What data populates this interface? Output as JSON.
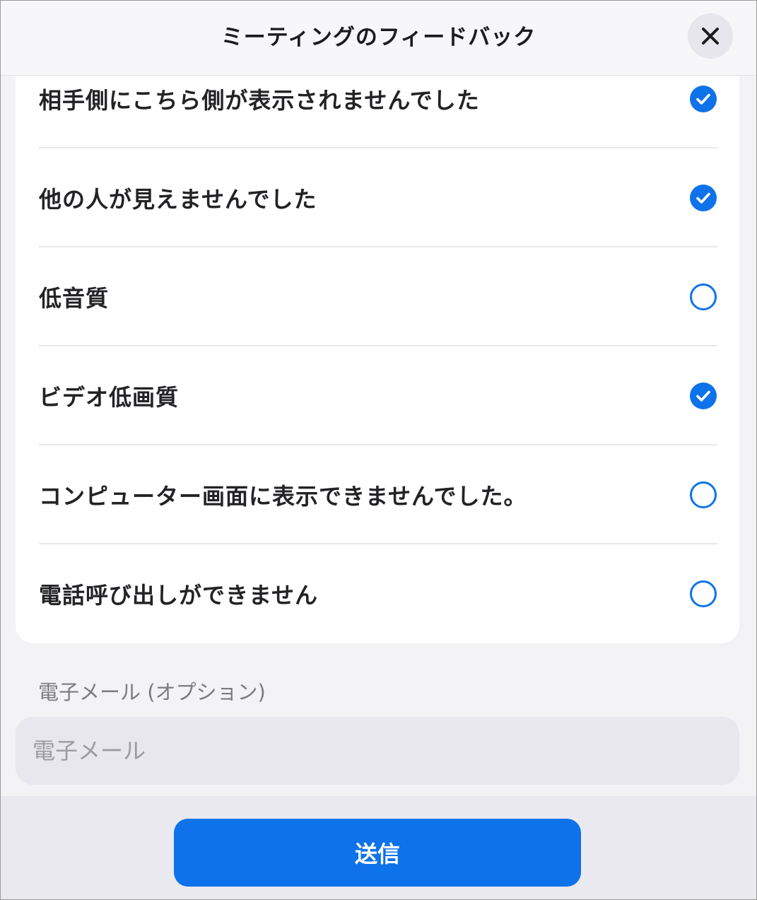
{
  "header": {
    "title": "ミーティングのフィードバック",
    "close_icon": "close-icon"
  },
  "options": [
    {
      "label": "相手側にこちら側が表示されませんでした",
      "checked": true
    },
    {
      "label": "他の人が見えませんでした",
      "checked": true
    },
    {
      "label": "低音質",
      "checked": false
    },
    {
      "label": "ビデオ低画質",
      "checked": true
    },
    {
      "label": "コンピューター画面に表示できませんでした。",
      "checked": false
    },
    {
      "label": "電話呼び出しができません",
      "checked": false
    }
  ],
  "email": {
    "label": "電子メール (オプション)",
    "placeholder": "電子メール",
    "value": ""
  },
  "submit": {
    "label": "送信"
  },
  "colors": {
    "accent": "#0e72ea",
    "background": "#f3f3f6",
    "card": "#ffffff",
    "text": "#232326"
  }
}
